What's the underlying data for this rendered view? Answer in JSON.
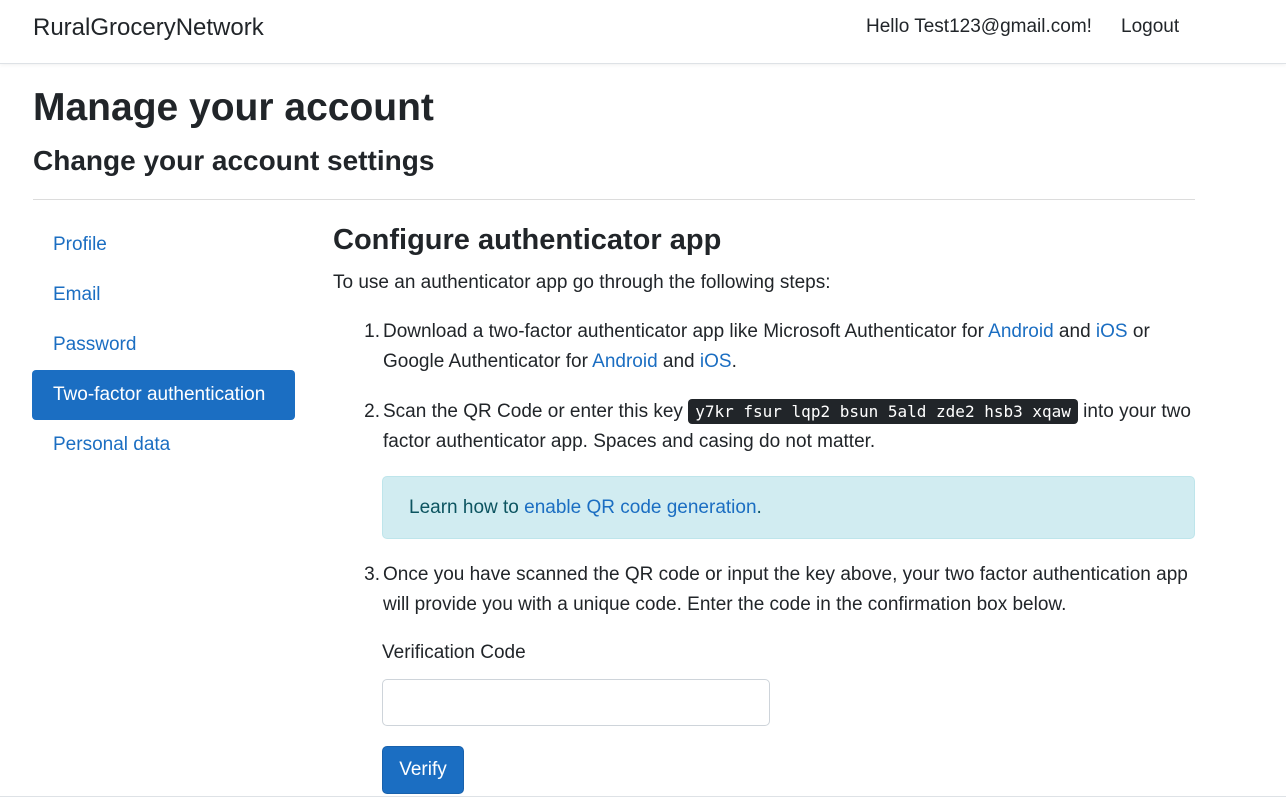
{
  "navbar": {
    "brand": "RuralGroceryNetwork",
    "greeting": "Hello Test123@gmail.com!",
    "logout": "Logout"
  },
  "page": {
    "title": "Manage your account",
    "subtitle": "Change your account settings"
  },
  "sidebar": {
    "items": [
      {
        "label": "Profile"
      },
      {
        "label": "Email"
      },
      {
        "label": "Password"
      },
      {
        "label": "Two-factor authentication",
        "active": true
      },
      {
        "label": "Personal data"
      }
    ]
  },
  "main": {
    "heading": "Configure authenticator app",
    "intro": "To use an authenticator app go through the following steps:",
    "step1": {
      "num": "1.",
      "text_a": "Download a two-factor authenticator app like Microsoft Authenticator for ",
      "link_android_1": "Android",
      "text_b": " and ",
      "link_ios_1": "iOS",
      "text_c": " or Google Authenticator for ",
      "link_android_2": "Android",
      "text_d": " and ",
      "link_ios_2": "iOS",
      "text_e": "."
    },
    "step2": {
      "num": "2.",
      "text_a": "Scan the QR Code or enter this key ",
      "key": "y7kr fsur lqp2 bsun 5ald zde2 hsb3 xqaw",
      "text_b": " into your two factor authenticator app. Spaces and casing do not matter."
    },
    "alert": {
      "text_a": "Learn how to ",
      "link": "enable QR code generation",
      "text_b": "."
    },
    "step3": {
      "num": "3.",
      "text": "Once you have scanned the QR code or input the key above, your two factor authentication app will provide you with a unique code. Enter the code in the confirmation box below."
    },
    "form": {
      "label": "Verification Code",
      "value": "",
      "button": "Verify"
    }
  },
  "colors": {
    "accent": "#1b6ec2",
    "alert_bg": "#d1ecf1",
    "key_bg": "#212529"
  }
}
